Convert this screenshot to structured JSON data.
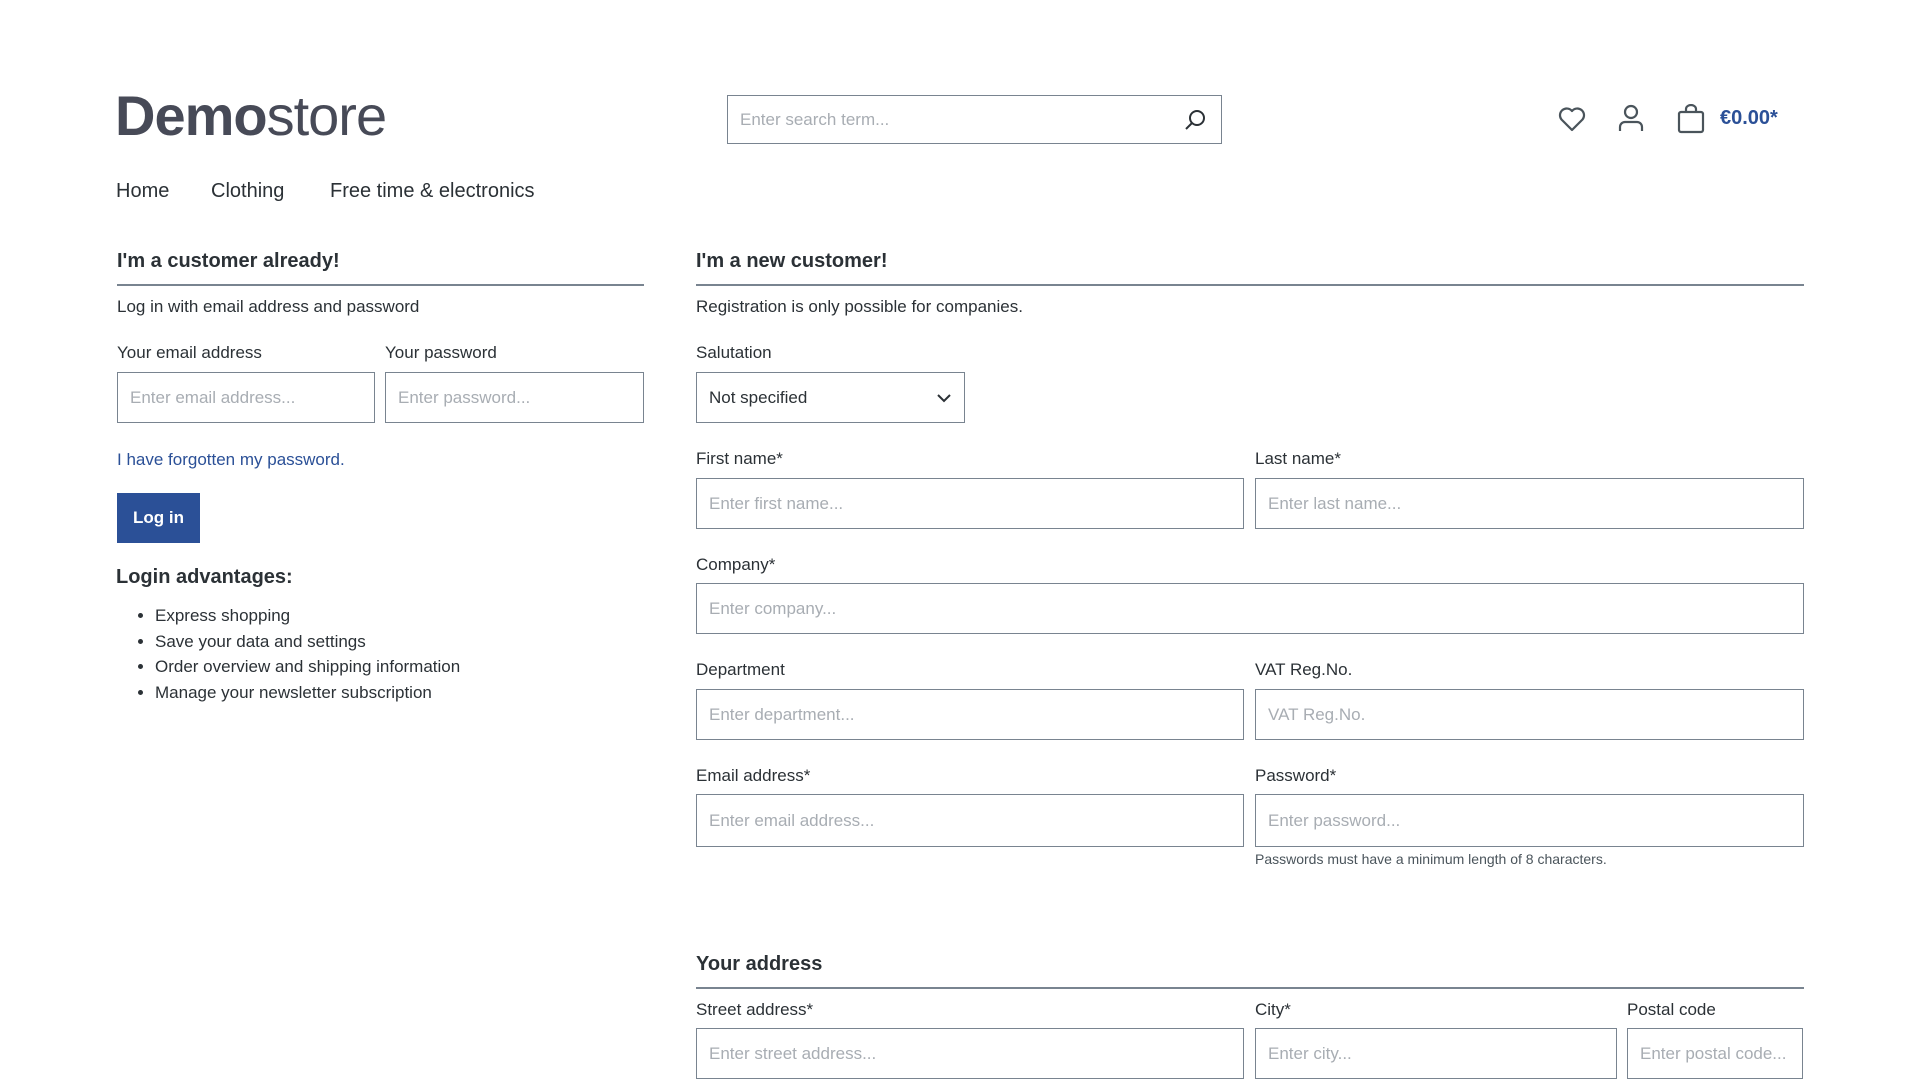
{
  "header": {
    "logo": {
      "bold": "Demo",
      "light": "store"
    },
    "search": {
      "placeholder": "Enter search term...",
      "icon": "search-icon"
    },
    "icons": [
      "heart-icon",
      "user-icon",
      "bag-icon"
    ],
    "cart_total": "€0.00*"
  },
  "nav": [
    {
      "label": "Home"
    },
    {
      "label": "Clothing"
    },
    {
      "label": "Free time & electronics"
    }
  ],
  "login": {
    "title": "I'm a customer already!",
    "intro": "Log in with email address and password",
    "email_label": "Your email address",
    "email_placeholder": "Enter email address...",
    "password_label": "Your password",
    "password_placeholder": "Enter password...",
    "forgot_link": "I have forgotten my password.",
    "button": "Log in",
    "advantages_title": "Login advantages:",
    "advantages": [
      "Express shopping",
      "Save your data and settings",
      "Order overview and shipping information",
      "Manage your newsletter subscription"
    ]
  },
  "register": {
    "title": "I'm a new customer!",
    "intro": "Registration is only possible for companies.",
    "salutation_label": "Salutation",
    "salutation_value": "Not specified",
    "first_name_label": "First name*",
    "first_name_placeholder": "Enter first name...",
    "last_name_label": "Last name*",
    "last_name_placeholder": "Enter last name...",
    "company_label": "Company*",
    "company_placeholder": "Enter company...",
    "department_label": "Department",
    "department_placeholder": "Enter department...",
    "vat_label": "VAT Reg.No.",
    "vat_placeholder": "VAT Reg.No.",
    "email_label": "Email address*",
    "email_placeholder": "Enter email address...",
    "password_label": "Password*",
    "password_placeholder": "Enter password...",
    "password_hint": "Passwords must have a minimum length of 8 characters."
  },
  "address": {
    "title": "Your address",
    "street_label": "Street address*",
    "street_placeholder": "Enter street address...",
    "city_label": "City*",
    "city_placeholder": "Enter city...",
    "postal_label": "Postal code",
    "postal_placeholder": "Enter postal code..."
  },
  "colors": {
    "primary": "#2b5097",
    "text": "#2b3136",
    "border": "#798490"
  }
}
